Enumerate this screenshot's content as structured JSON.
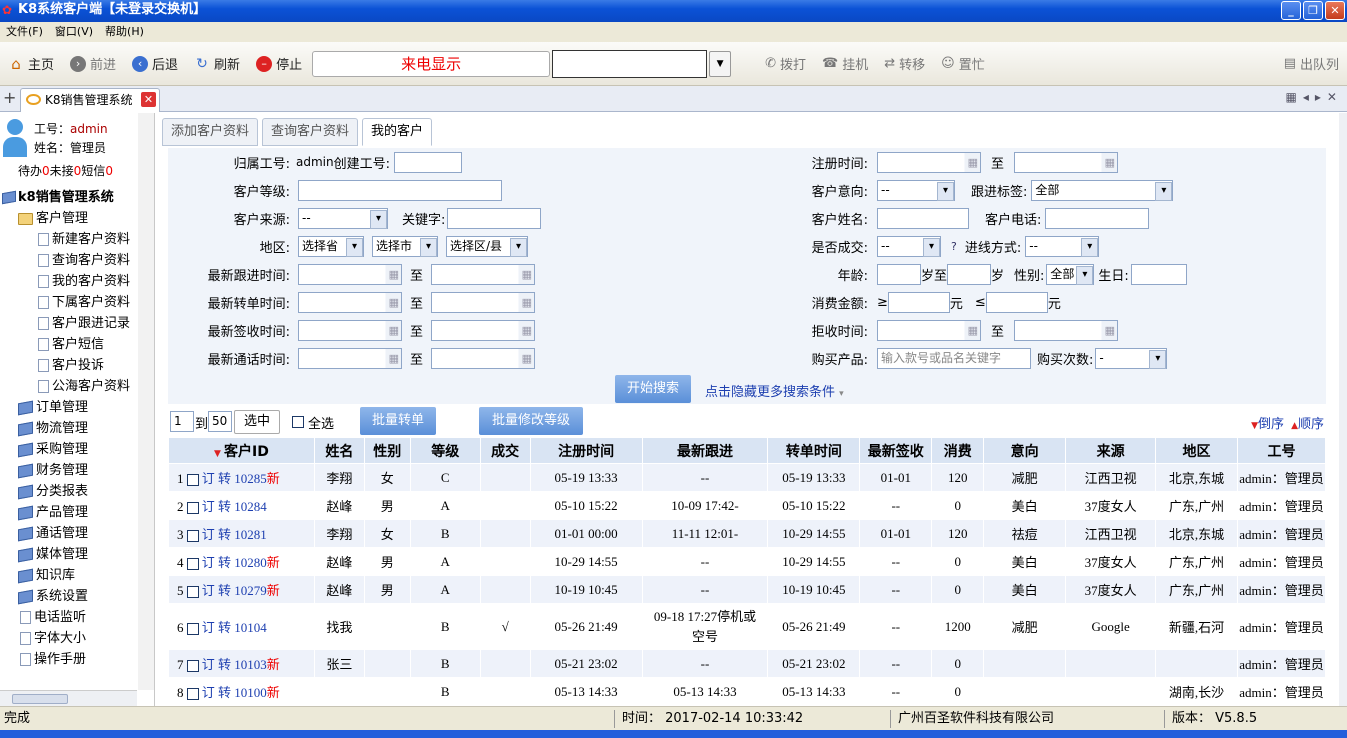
{
  "window": {
    "title": "K8系统客户端【未登录交换机】"
  },
  "menu": [
    "文件(F)",
    "窗口(V)",
    "帮助(H)"
  ],
  "toolbar": {
    "home": "主页",
    "forward": "前进",
    "back": "后退",
    "refresh": "刷新",
    "stop": "停止",
    "caller_display": "来电显示",
    "dial": "拨打",
    "hangup": "挂机",
    "transfer": "转移",
    "busy": "置忙",
    "exit_queue": "出队列"
  },
  "tab": {
    "label": "K8销售管理系统"
  },
  "user": {
    "id_label": "工号：",
    "id_value": "admin",
    "name_label": "姓名：",
    "name_value": "管理员"
  },
  "pending": {
    "todo_label": "待办",
    "todo": "0",
    "unanswered_label": "未接",
    "unanswered": "0",
    "sms_label": "短信",
    "sms": "0"
  },
  "tree": {
    "root": "k8销售管理系统",
    "customer": "客户管理",
    "customer_children": [
      "新建客户资料",
      "查询客户资料",
      "我的客户资料",
      "下属客户资料",
      "客户跟进记录",
      "客户短信",
      "客户投诉",
      "公海客户资料"
    ],
    "modules": [
      "订单管理",
      "物流管理",
      "采购管理",
      "财务管理",
      "分类报表",
      "产品管理",
      "通话管理",
      "媒体管理",
      "知识库",
      "系统设置"
    ],
    "extras": [
      "电话监听",
      "字体大小",
      "操作手册"
    ]
  },
  "subtabs": [
    "添加客户资料",
    "查询客户资料",
    "我的客户"
  ],
  "search": {
    "owner_label": "归属工号:",
    "owner_value": "admin",
    "creator_label": "创建工号:",
    "level_label": "客户等级:",
    "source_label": "客户来源:",
    "source_value": "--",
    "keyword_label": "关键字:",
    "region_label": "地区:",
    "province": "选择省",
    "city": "选择市",
    "district": "选择区/县",
    "follow_time_label": "最新跟进时间:",
    "transfer_time_label": "最新转单时间:",
    "sign_time_label": "最新签收时间:",
    "call_time_label": "最新通话时间:",
    "to": "至",
    "reg_time_label": "注册时间:",
    "intent_label": "客户意向:",
    "intent_value": "--",
    "tag_label": "跟进标签:",
    "tag_value": "全部",
    "name_label": "客户姓名:",
    "phone_label": "客户电话:",
    "deal_label": "是否成交:",
    "deal_value": "--",
    "q": "?",
    "channel_label": "进线方式:",
    "channel_value": "--",
    "age_label": "年龄:",
    "age_to": "岁至",
    "age_unit": "岁",
    "gender_label": "性别:",
    "gender_value": "全部",
    "birthday_label": "生日:",
    "spend_label": "消费金额:",
    "ge": "≥",
    "yuan1": "元",
    "le": "≤",
    "yuan2": "元",
    "reject_label": "拒收时间:",
    "product_label": "购买产品:",
    "product_placeholder": "输入款号或品名关键字",
    "times_label": "购买次数:",
    "times_value": "-",
    "search_button": "开始搜索",
    "toggle_link": "点击隐藏更多搜索条件"
  },
  "listbar": {
    "from": "1",
    "to_label": "到",
    "to": "50",
    "select_button": "选中",
    "all_label": "全选",
    "batch_transfer": "批量转单",
    "batch_level": "批量修改等级",
    "desc": "倒序",
    "asc": "顺序"
  },
  "columns": [
    "客户ID",
    "姓名",
    "性别",
    "等级",
    "成交",
    "注册时间",
    "最新跟进",
    "转单时间",
    "最新签收",
    "消费",
    "意向",
    "来源",
    "地区",
    "工号"
  ],
  "row_actions": {
    "order": "订",
    "transfer": "转",
    "new": "新"
  },
  "rows": [
    {
      "n": "1",
      "id": "10285",
      "new": true,
      "name": "李翔",
      "gender": "女",
      "level": "C",
      "deal": "",
      "reg": "05-19 13:33",
      "follow": "--",
      "trans": "05-19 13:33",
      "sign": "01-01",
      "spend": "120",
      "intent": "减肥",
      "source": "江西卫视",
      "region": "北京,东城",
      "staff": "admin：管理员"
    },
    {
      "n": "2",
      "id": "10284",
      "new": false,
      "name": "赵峰",
      "gender": "男",
      "level": "A",
      "deal": "",
      "reg": "05-10 15:22",
      "follow": "10-09 17:42-",
      "trans": "05-10 15:22",
      "sign": "--",
      "spend": "0",
      "intent": "美白",
      "source": "37度女人",
      "region": "广东,广州",
      "staff": "admin：管理员"
    },
    {
      "n": "3",
      "id": "10281",
      "new": false,
      "name": "李翔",
      "gender": "女",
      "level": "B",
      "deal": "",
      "reg": "01-01 00:00",
      "follow": "11-11 12:01-",
      "trans": "10-29 14:55",
      "sign": "01-01",
      "spend": "120",
      "intent": "祛痘",
      "source": "江西卫视",
      "region": "北京,东城",
      "staff": "admin：管理员"
    },
    {
      "n": "4",
      "id": "10280",
      "new": true,
      "name": "赵峰",
      "gender": "男",
      "level": "A",
      "deal": "",
      "reg": "10-29 14:55",
      "follow": "--",
      "trans": "10-29 14:55",
      "sign": "--",
      "spend": "0",
      "intent": "美白",
      "source": "37度女人",
      "region": "广东,广州",
      "staff": "admin：管理员"
    },
    {
      "n": "5",
      "id": "10279",
      "new": true,
      "name": "赵峰",
      "gender": "男",
      "level": "A",
      "deal": "",
      "reg": "10-19 10:45",
      "follow": "--",
      "trans": "10-19 10:45",
      "sign": "--",
      "spend": "0",
      "intent": "美白",
      "source": "37度女人",
      "region": "广东,广州",
      "staff": "admin：管理员"
    },
    {
      "n": "6",
      "id": "10104",
      "new": false,
      "name": "找我",
      "gender": "",
      "level": "B",
      "deal": "√",
      "reg": "05-26 21:49",
      "follow": "09-18 17:27停机或空号",
      "trans": "05-26 21:49",
      "sign": "--",
      "spend": "1200",
      "intent": "减肥",
      "source": "Google",
      "region": "新疆,石河",
      "staff": "admin：管理员"
    },
    {
      "n": "7",
      "id": "10103",
      "new": true,
      "name": "张三",
      "gender": "",
      "level": "B",
      "deal": "",
      "reg": "05-21 23:02",
      "follow": "--",
      "trans": "05-21 23:02",
      "sign": "--",
      "spend": "0",
      "intent": "",
      "source": "",
      "region": "",
      "staff": "admin：管理员"
    },
    {
      "n": "8",
      "id": "10100",
      "new": true,
      "name": "",
      "gender": "",
      "level": "B",
      "deal": "",
      "reg": "05-13 14:33",
      "follow": "05-13 14:33",
      "trans": "05-13 14:33",
      "sign": "--",
      "spend": "0",
      "intent": "",
      "source": "",
      "region": "湖南,长沙",
      "staff": "admin：管理员"
    }
  ],
  "status": {
    "state": "完成",
    "time": "时间：  2017-02-14 10:33:42",
    "company": "广州百圣软件科技有限公司",
    "version": "版本：  V5.8.5"
  }
}
